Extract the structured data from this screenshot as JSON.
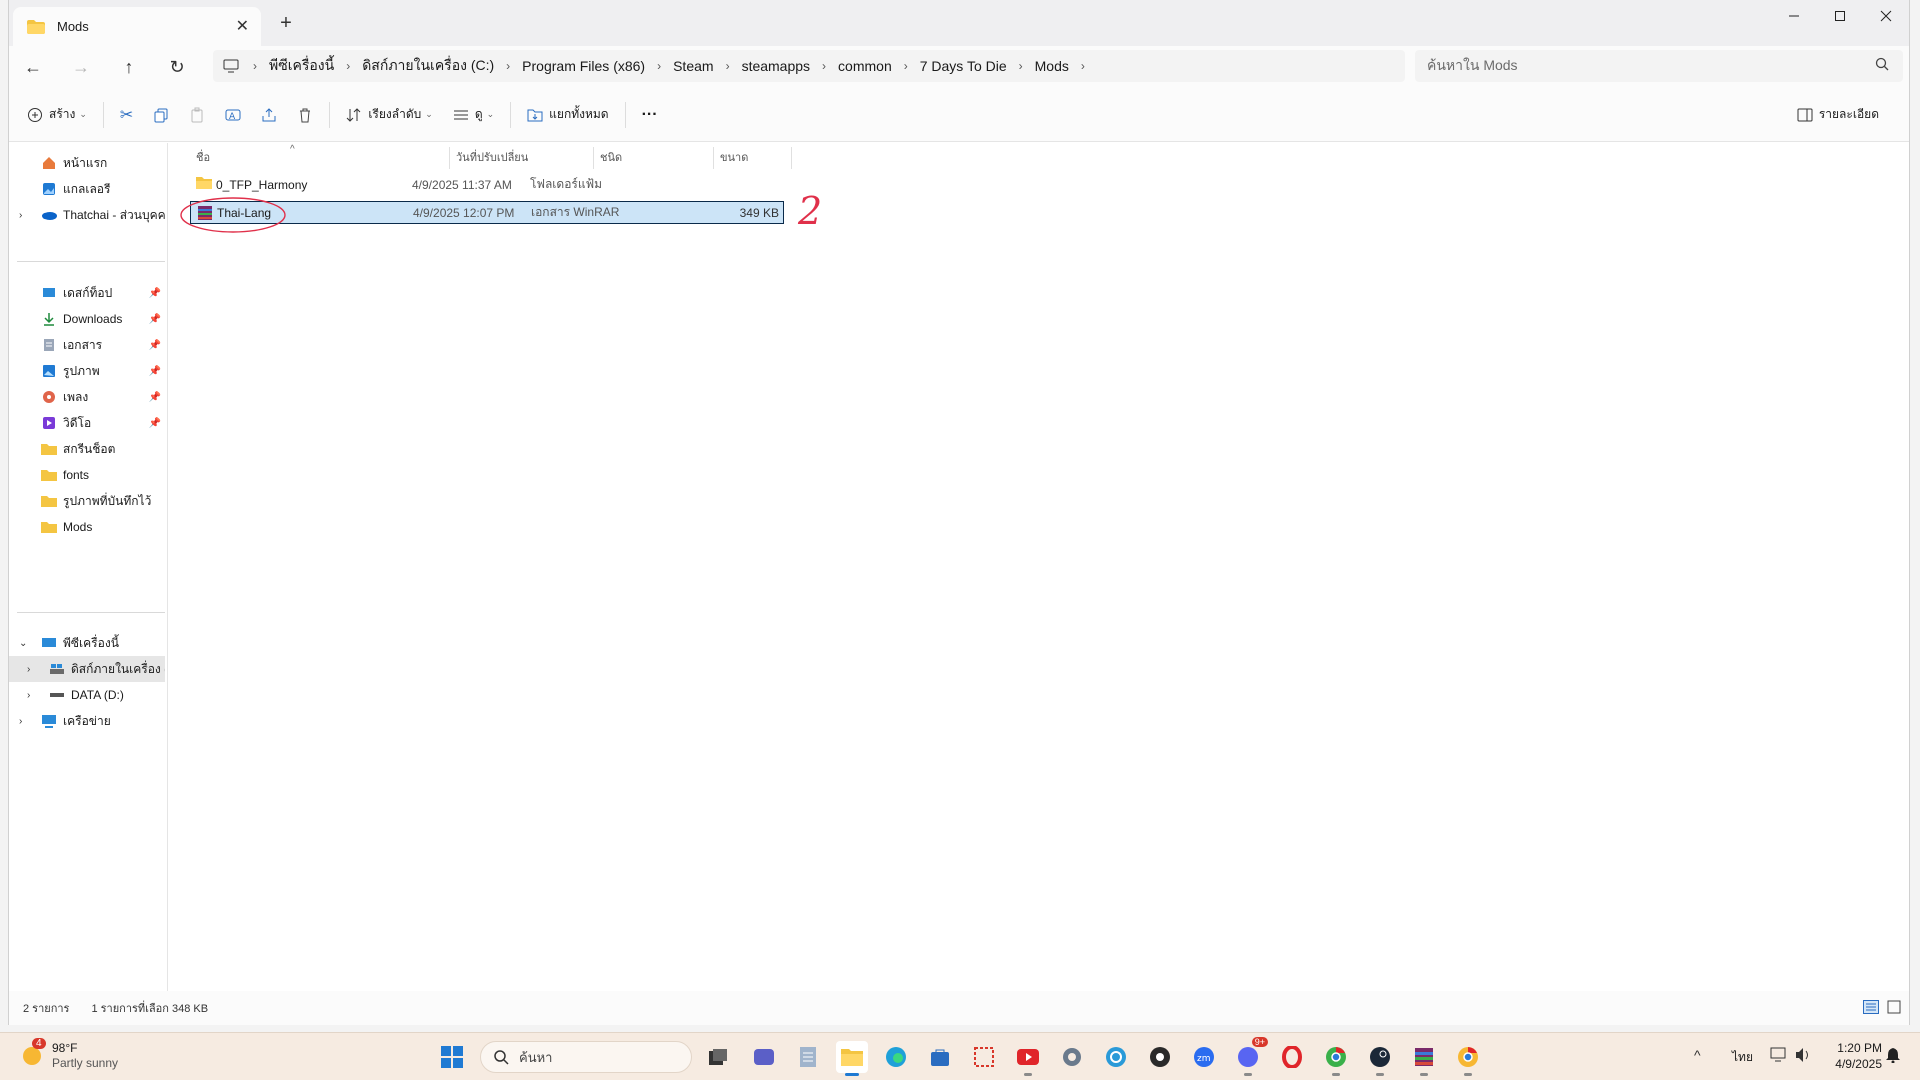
{
  "window": {
    "tab_title": "Mods",
    "new_tab": "+",
    "close_tab": "✕"
  },
  "nav_buttons": {
    "back": "←",
    "forward": "→",
    "up": "↑",
    "refresh": "↻"
  },
  "breadcrumb": [
    "พีซีเครื่องนี้",
    "ดิสก์ภายในเครื่อง (C:)",
    "Program Files (x86)",
    "Steam",
    "steamapps",
    "common",
    "7 Days To Die",
    "Mods"
  ],
  "search": {
    "placeholder": "ค้นหาใน Mods"
  },
  "toolbar": {
    "new_label": "สร้าง",
    "sort_label": "เรียงลำดับ",
    "view_label": "ดู",
    "extract_label": "แยกทั้งหมด",
    "more_label": "···",
    "details_label": "รายละเอียด"
  },
  "sidebar": {
    "top": [
      {
        "label": "หน้าแรก",
        "icon": "home-icon"
      },
      {
        "label": "แกลเลอรี",
        "icon": "gallery-icon"
      },
      {
        "label": "Thatchai - ส่วนบุคคล",
        "icon": "onedrive-icon"
      }
    ],
    "pinned": [
      {
        "label": "เดสก์ท็อป",
        "icon": "desktop-icon"
      },
      {
        "label": "Downloads",
        "icon": "download-icon"
      },
      {
        "label": "เอกสาร",
        "icon": "documents-icon"
      },
      {
        "label": "รูปภาพ",
        "icon": "pictures-icon"
      },
      {
        "label": "เพลง",
        "icon": "music-icon"
      },
      {
        "label": "วิดีโอ",
        "icon": "video-icon"
      },
      {
        "label": "สกรีนช็อต",
        "icon": "folder-icon"
      },
      {
        "label": "fonts",
        "icon": "folder-icon"
      },
      {
        "label": "รูปภาพที่บันทึกไว้",
        "icon": "folder-icon"
      },
      {
        "label": "Mods",
        "icon": "folder-icon"
      }
    ],
    "tree": [
      {
        "label": "พีซีเครื่องนี้",
        "icon": "pc-icon"
      },
      {
        "label": "ดิสก์ภายในเครื่อง (C:)",
        "icon": "drive-c-icon"
      },
      {
        "label": "DATA (D:)",
        "icon": "drive-icon"
      },
      {
        "label": "เครือข่าย",
        "icon": "network-icon"
      }
    ]
  },
  "columns": [
    "ชื่อ",
    "วันที่ปรับเปลี่ยน",
    "ชนิด",
    "ขนาด"
  ],
  "files": [
    {
      "name": "0_TFP_Harmony",
      "modified": "4/9/2025 11:37 AM",
      "type": "โฟลเดอร์แฟ้ม",
      "size": ""
    },
    {
      "name": "Thai-Lang",
      "modified": "4/9/2025 12:07 PM",
      "type": "เอกสาร WinRAR",
      "size": "349 KB"
    }
  ],
  "annotation_text": "2",
  "status": {
    "count": "2 รายการ",
    "selected": "1 รายการที่เลือก 348 KB"
  },
  "taskbar": {
    "weather_temp": "98°F",
    "weather_desc": "Partly sunny",
    "weather_badge": "4",
    "search_label": "ค้นหา",
    "lang": "ไทย",
    "time": "1:20 PM",
    "date": "4/9/2025",
    "discord_badge": "9+"
  },
  "colors": {
    "accent": "#0067c0",
    "folder": "#f4c542",
    "selection": "#cce4f7",
    "annotation": "#e0304a"
  }
}
